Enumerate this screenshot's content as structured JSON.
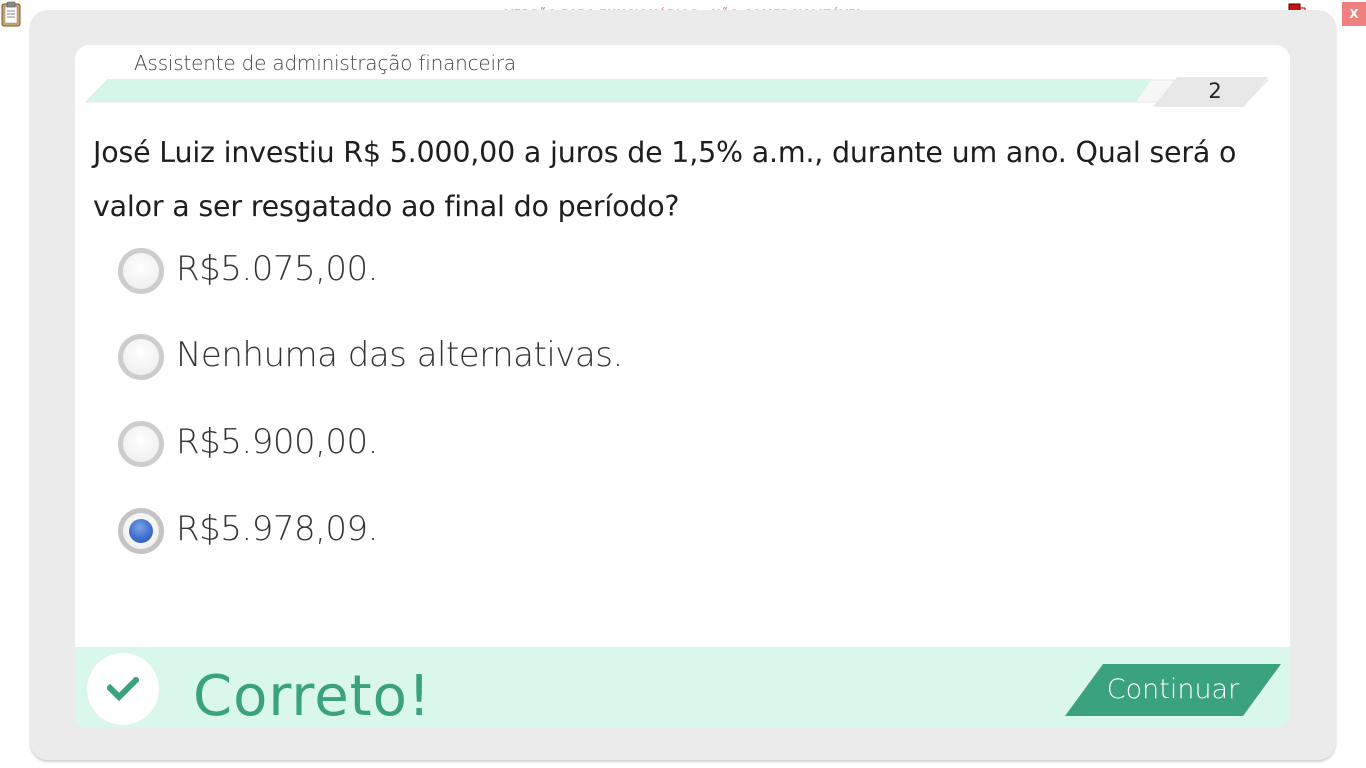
{
  "window": {
    "watermark": "VERSÃO PARA FUNCIONÁRIOS - NÃO COMERCIALIZÁVEL",
    "close_label": "X",
    "icons": [
      "clipboard-icon",
      "network-status-icon"
    ]
  },
  "header": {
    "title": "Assistente de administração financeira",
    "step_number": "2",
    "progress_fraction": 0.9
  },
  "question": {
    "text": "José Luiz investiu R$ 5.000,00 a juros de 1,5% a.m., durante um ano. Qual será o valor a ser resgatado ao final do período?"
  },
  "options": [
    {
      "label": "R$5.075,00.",
      "selected": false
    },
    {
      "label": "Nenhuma das alternativas.",
      "selected": false
    },
    {
      "label": "R$5.900,00.",
      "selected": false
    },
    {
      "label": "R$5.978,09.",
      "selected": true
    }
  ],
  "feedback": {
    "status": "Correto!",
    "continue_label": "Continuar"
  },
  "colors": {
    "accent_green": "#3aa27e",
    "feedback_bg": "#d9f7ea",
    "progress_fill": "#d6f6ea",
    "selected_radio": "#3f6fce",
    "watermark": "#f26b6b"
  }
}
